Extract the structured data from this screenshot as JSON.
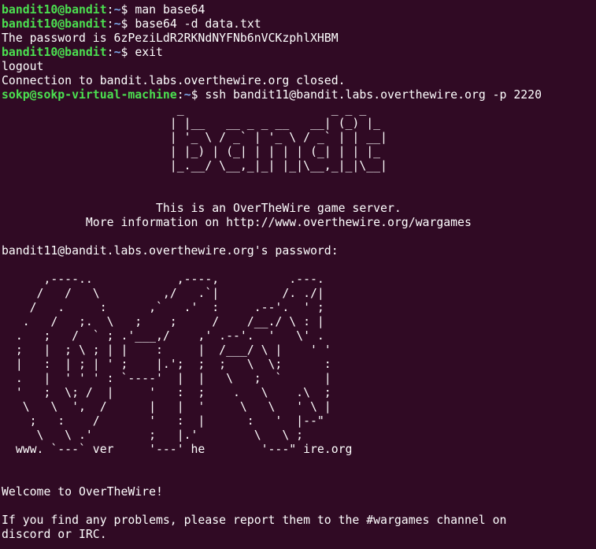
{
  "terminal": {
    "background": "#300a24",
    "prompt_user_color": "#4be050",
    "prompt_path_color": "#7ba6e6",
    "text_color": "#ffffff",
    "lines": [
      {
        "type": "prompt",
        "user": "bandit10@bandit",
        "sep": ":",
        "path": "~",
        "sigil": "$ ",
        "cmd": "man base64"
      },
      {
        "type": "prompt",
        "user": "bandit10@bandit",
        "sep": ":",
        "path": "~",
        "sigil": "$ ",
        "cmd": "base64 -d data.txt"
      },
      {
        "type": "out",
        "text": "The password is 6zPeziLdR2RKNdNYFNb6nVCKzphlXHBM"
      },
      {
        "type": "prompt",
        "user": "bandit10@bandit",
        "sep": ":",
        "path": "~",
        "sigil": "$ ",
        "cmd": "exit"
      },
      {
        "type": "out",
        "text": "logout"
      },
      {
        "type": "out",
        "text": "Connection to bandit.labs.overthewire.org closed."
      },
      {
        "type": "prompt",
        "user": "sokp@sokp-virtual-machine",
        "sep": ":",
        "path": "~",
        "sigil": "$ ",
        "cmd": "ssh bandit11@bandit.labs.overthewire.org -p 2220"
      },
      {
        "type": "art",
        "text": "                         _                     _ _ _"
      },
      {
        "type": "art",
        "text": "                        | |__   __ _ _ __   __| (_) |_"
      },
      {
        "type": "art",
        "text": "                        | '_ \\ / _` | '_ \\ / _` | | __|"
      },
      {
        "type": "art",
        "text": "                        | |_) | (_| | | | | (_| | | |_"
      },
      {
        "type": "art",
        "text": "                        |_.__/ \\__,_|_| |_|\\__,_|_|\\__|"
      },
      {
        "type": "out",
        "text": ""
      },
      {
        "type": "out",
        "text": ""
      },
      {
        "type": "out",
        "text": "                      This is an OverTheWire game server."
      },
      {
        "type": "out",
        "text": "            More information on http://www.overthewire.org/wargames"
      },
      {
        "type": "out",
        "text": ""
      },
      {
        "type": "out",
        "text": "bandit11@bandit.labs.overthewire.org's password:"
      },
      {
        "type": "out",
        "text": ""
      },
      {
        "type": "art",
        "text": "      ,----..            ,----,          .---."
      },
      {
        "type": "art",
        "text": "     /   /   \\         ,/   .`|         /. ./|"
      },
      {
        "type": "art",
        "text": "    /   .     :      ,`   .'  :     .--'.  ' ;"
      },
      {
        "type": "art",
        "text": "   .   /   ;.  \\   ;    ;     /    /__./ \\ : |"
      },
      {
        "type": "art",
        "text": "  .   ;   /  ` ; .'___,/    ,' .--'.  '   \\' ."
      },
      {
        "type": "art",
        "text": "  ;   |  ; \\ ; | |    :     |  /___/ \\ |    ' '"
      },
      {
        "type": "art",
        "text": "  |   :  | ; | ' ;    |.';  ;  ;   \\  \\;      :"
      },
      {
        "type": "art",
        "text": "  .   |  ' ' ' : `----'  |  |   \\   ;  `      |"
      },
      {
        "type": "art",
        "text": "  '   ;  \\; /  |     '   :  ;    .   \\    .\\  ;"
      },
      {
        "type": "art",
        "text": "   \\   \\  ',  /      |   |  '     \\   \\   ' \\ |"
      },
      {
        "type": "art",
        "text": "    ;   :    /       '   :  |      :   '  |--\""
      },
      {
        "type": "art",
        "text": "     \\   \\ .'        ;   |.'        \\   \\ ;"
      },
      {
        "type": "art",
        "text": "  www. `---` ver     '---' he        '---\" ire.org"
      },
      {
        "type": "out",
        "text": ""
      },
      {
        "type": "out",
        "text": ""
      },
      {
        "type": "out",
        "text": "Welcome to OverTheWire!"
      },
      {
        "type": "out",
        "text": ""
      },
      {
        "type": "out",
        "text": "If you find any problems, please report them to the #wargames channel on"
      },
      {
        "type": "out",
        "text": "discord or IRC."
      }
    ]
  }
}
